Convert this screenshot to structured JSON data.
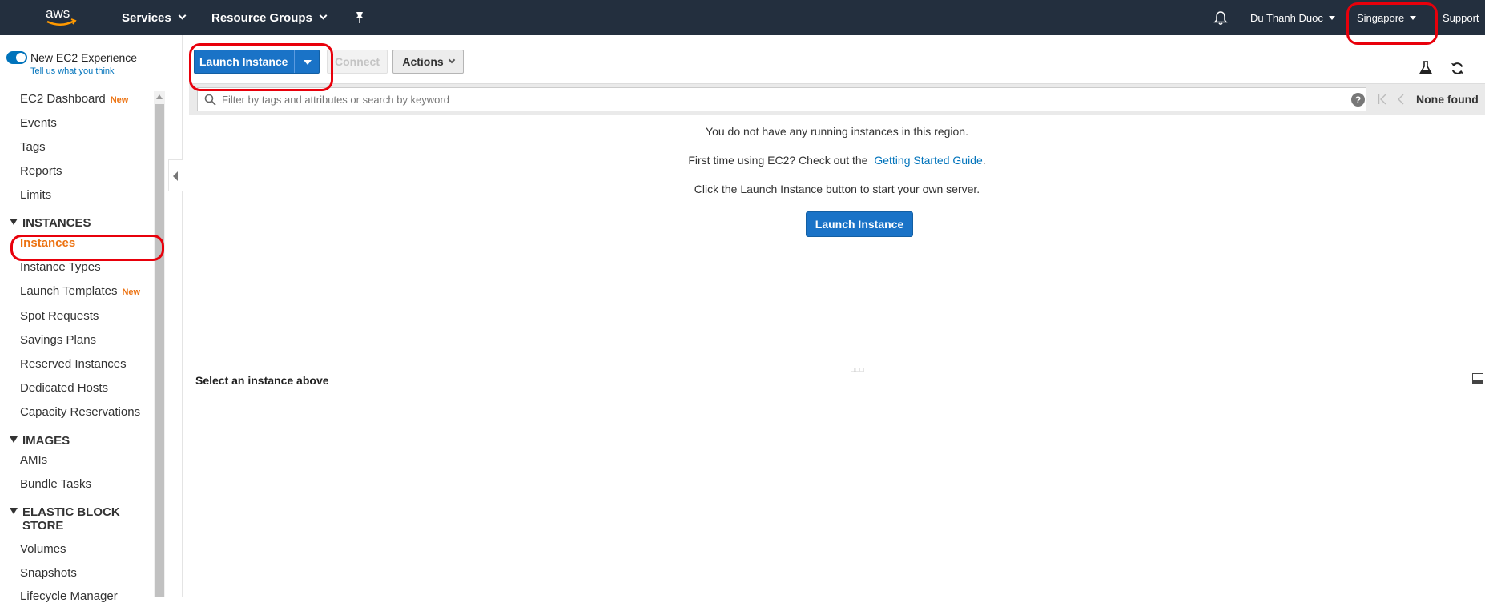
{
  "topnav": {
    "logo": "aws",
    "services": "Services",
    "resource_groups": "Resource Groups",
    "pin_icon": "pin-icon",
    "bell_icon": "bell-icon",
    "user": "Du Thanh Duoc",
    "region": "Singapore",
    "support": "Support"
  },
  "sidebar": {
    "new_experience": "New EC2 Experience",
    "tell_us": "Tell us what you think",
    "new_badge": "New",
    "items": {
      "dashboard": "EC2 Dashboard",
      "events": "Events",
      "tags": "Tags",
      "reports": "Reports",
      "limits": "Limits",
      "instances_section": "INSTANCES",
      "instances": "Instances",
      "instance_types": "Instance Types",
      "launch_templates": "Launch Templates",
      "spot_requests": "Spot Requests",
      "savings_plans": "Savings Plans",
      "reserved_instances": "Reserved Instances",
      "dedicated_hosts": "Dedicated Hosts",
      "capacity_reservations": "Capacity Reservations",
      "images_section": "IMAGES",
      "amis": "AMIs",
      "bundle_tasks": "Bundle Tasks",
      "ebs_section_line1": "ELASTIC BLOCK",
      "ebs_section_line2": "STORE",
      "volumes": "Volumes",
      "snapshots": "Snapshots",
      "lifecycle_manager": "Lifecycle Manager"
    }
  },
  "toolbar": {
    "launch_instance": "Launch Instance",
    "connect": "Connect",
    "actions": "Actions"
  },
  "filter": {
    "placeholder": "Filter by tags and attributes or search by keyword",
    "help": "?",
    "none_found": "None found"
  },
  "main": {
    "no_instances": "You do not have any running instances in this region.",
    "first_time": "First time using EC2? Check out the",
    "guide_link": "Getting Started Guide",
    "guide_period": ".",
    "click_launch": "Click the Launch Instance button to start your own server.",
    "launch_button": "Launch Instance",
    "select_instance": "Select an instance above"
  },
  "colors": {
    "nav_bg": "#232f3e",
    "primary": "#1a73c7",
    "active": "#ec7211",
    "annotation": "#e8000b"
  }
}
